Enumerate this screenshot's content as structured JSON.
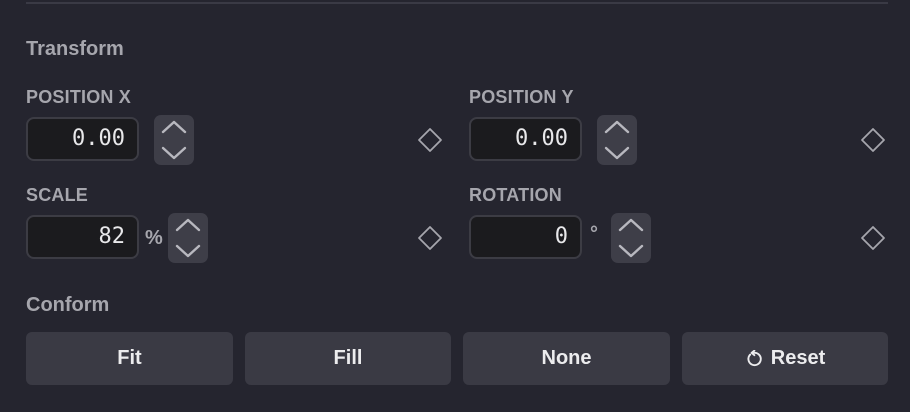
{
  "transform": {
    "title": "Transform",
    "position_x": {
      "label": "POSITION X",
      "value": "0.00",
      "unit": ""
    },
    "position_y": {
      "label": "POSITION Y",
      "value": "0.00",
      "unit": ""
    },
    "scale": {
      "label": "SCALE",
      "value": "82",
      "unit": "%"
    },
    "rotation": {
      "label": "ROTATION",
      "value": "0",
      "unit": "°"
    }
  },
  "conform": {
    "title": "Conform",
    "buttons": [
      {
        "label": "Fit"
      },
      {
        "label": "Fill"
      },
      {
        "label": "None"
      },
      {
        "label": "Reset",
        "icon": "reset-icon"
      }
    ]
  },
  "colors": {
    "background": "#25252f",
    "input_background": "#1b1b1e",
    "button_background": "#3a3a44",
    "label_text": "#a6a6ad"
  },
  "icons": [
    "chevron-up-icon",
    "chevron-down-icon",
    "keyframe-diamond-icon",
    "reset-icon"
  ]
}
